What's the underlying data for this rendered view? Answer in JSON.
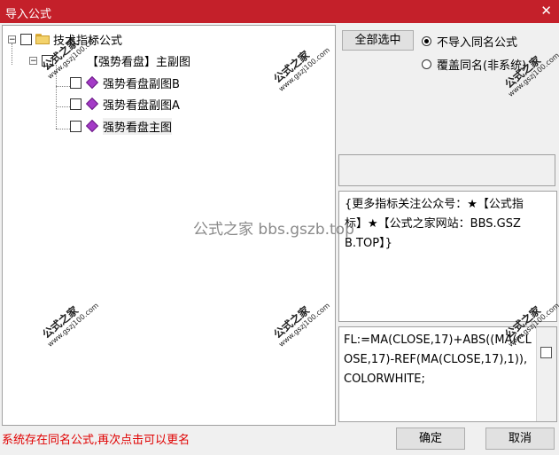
{
  "window": {
    "title": "导入公式",
    "close_glyph": "✕"
  },
  "tree": {
    "root_label": "技术指标公式",
    "group_label": "【强势看盘】主副图",
    "items": [
      {
        "label": "强势看盘副图B"
      },
      {
        "label": "强势看盘副图A"
      },
      {
        "label": "强势看盘主图"
      }
    ]
  },
  "options": {
    "select_all_label": "全部选中",
    "radio_no_import": "不导入同名公式",
    "radio_overwrite": "覆盖同名(非系统)",
    "selected": "no_import"
  },
  "description": "{更多指标关注公众号：★【公式指标】★【公式之家网站：BBS.GSZB.TOP】}",
  "code": "FL:=MA(CLOSE,17)+ABS((MA(CLOSE,17)-REF(MA(CLOSE,17),1)),COLORWHITE;",
  "status_message": "系统存在同名公式,再次点击可以更名",
  "buttons": {
    "ok_label": "确定",
    "cancel_label": "取消"
  },
  "watermarks": {
    "center": "公式之家 bbs.gszb.top",
    "stamp_text": "公式之家",
    "stamp_url": "www.gszj100.com"
  },
  "colors": {
    "title_bar": "#c4202a",
    "status_text": "#e00000"
  }
}
